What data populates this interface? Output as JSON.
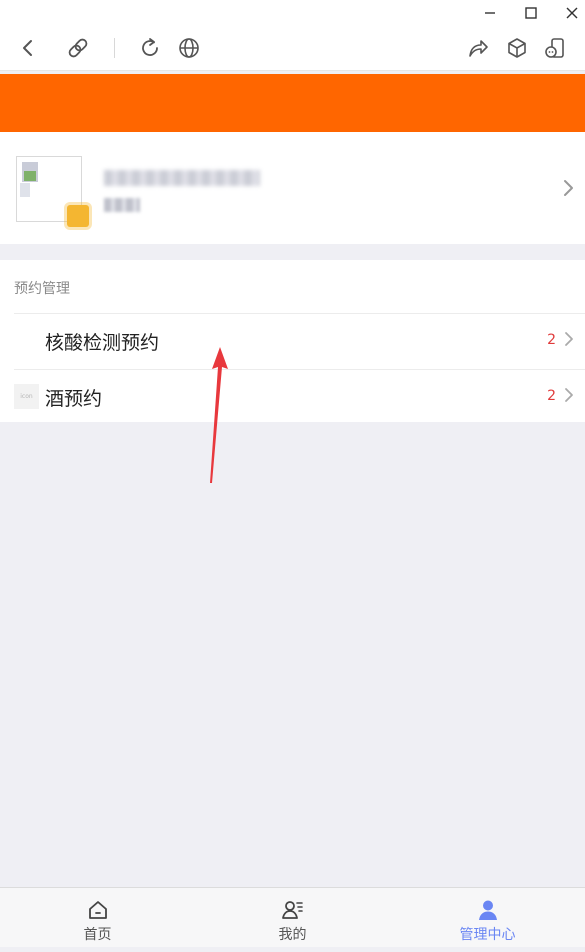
{
  "window": {
    "controls": [
      {
        "name": "minimize",
        "icon": "minimize-icon"
      },
      {
        "name": "maximize",
        "icon": "maximize-icon"
      },
      {
        "name": "close",
        "icon": "close-icon"
      }
    ]
  },
  "toolbar": {
    "left_icons": [
      "back-icon",
      "link-icon",
      "refresh-icon",
      "globe-icon"
    ],
    "right_icons": [
      "share-icon",
      "cube-icon",
      "mini-device-icon"
    ]
  },
  "colors": {
    "header_orange": "#ff6600",
    "count_red": "#e03b3b",
    "active_tab_blue": "#6a86f3",
    "arrow_red": "#e8383d"
  },
  "profile": {
    "name": "",
    "subtitle": ""
  },
  "section": {
    "title": "预约管理",
    "items": [
      {
        "label": "核酸检测预约",
        "count": "2",
        "icon": ""
      },
      {
        "label": "酒预约",
        "count": "2",
        "icon": "icon"
      }
    ]
  },
  "tabbar": {
    "tabs": [
      {
        "label": "首页",
        "icon": "home-icon",
        "active": false
      },
      {
        "label": "我的",
        "icon": "user-list-icon",
        "active": false
      },
      {
        "label": "管理中心",
        "icon": "person-icon",
        "active": true
      }
    ]
  }
}
